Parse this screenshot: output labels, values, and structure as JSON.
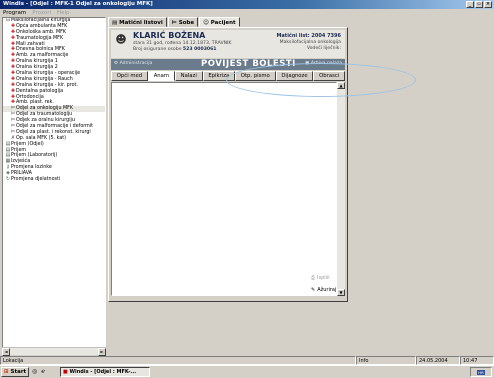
{
  "window": {
    "title": "Windis - [Odjel : MFK-1 Odjel za onkologiju MFK]"
  },
  "menu": [
    "Program",
    "Prozori",
    "Help"
  ],
  "tree": [
    {
      "label": "Maksilofacijalna kirurgija",
      "icon": "folder-icon",
      "indent": 0
    },
    {
      "label": "Opća ambulanta MFK",
      "icon": "plus-red-icon",
      "indent": 1
    },
    {
      "label": "Onkološka amb. MFK",
      "icon": "plus-red-icon",
      "indent": 1
    },
    {
      "label": "Traumatologija MFK",
      "icon": "plus-red-icon",
      "indent": 1
    },
    {
      "label": "Mali zahvati",
      "icon": "plus-red-icon",
      "indent": 1
    },
    {
      "label": "Dnevna bolnica MFK",
      "icon": "plus-red-icon",
      "indent": 1
    },
    {
      "label": "Amb. za malformacije",
      "icon": "plus-red-icon",
      "indent": 1
    },
    {
      "label": "Oralna kirurgija 1",
      "icon": "plus-red-icon",
      "indent": 1
    },
    {
      "label": "Oralna kirurgija 2",
      "icon": "plus-red-icon",
      "indent": 1
    },
    {
      "label": "Oralna kirurgija - operacije",
      "icon": "plus-red-icon",
      "indent": 1
    },
    {
      "label": "Oralna kirurgija - Rauch",
      "icon": "plus-red-icon",
      "indent": 1
    },
    {
      "label": "Oralna kirurgija - kir. prot.",
      "icon": "plus-red-icon",
      "indent": 1
    },
    {
      "label": "Dentalna patologija",
      "icon": "plus-red-icon",
      "indent": 1
    },
    {
      "label": "Ortodoncija",
      "icon": "plus-red-icon",
      "indent": 1
    },
    {
      "label": "Amb. plast. rek.",
      "icon": "plus-red-icon",
      "indent": 1
    },
    {
      "label": "Odjel za onkologiju MFK",
      "icon": "bed-icon",
      "indent": 1,
      "selected": true
    },
    {
      "label": "Odjel za traumatologiju",
      "icon": "bed-icon",
      "indent": 1
    },
    {
      "label": "Odjek za oralnu kirurgiju",
      "icon": "bed-icon",
      "indent": 1
    },
    {
      "label": "Odjel za malformacije i deformit",
      "icon": "bed-icon",
      "indent": 1
    },
    {
      "label": "Odjel za plast. i rekonst. kirurgi",
      "icon": "bed-icon",
      "indent": 1
    },
    {
      "label": "Op. sala MFK (5. kat)",
      "icon": "operating-icon",
      "indent": 1
    },
    {
      "label": "Prijem (Odjel)",
      "icon": "book-icon",
      "indent": 0
    },
    {
      "label": "Prijem",
      "icon": "book-icon",
      "indent": 0
    },
    {
      "label": "Prijem (Laboratorij)",
      "icon": "book-icon",
      "indent": 0
    },
    {
      "label": "Izvješća",
      "icon": "report-icon",
      "indent": 0
    },
    {
      "label": "Promjena lozinke",
      "icon": "key-icon",
      "indent": 0
    },
    {
      "label": "PRILIAVA",
      "icon": "login-icon",
      "indent": 0
    },
    {
      "label": "Promjena djelatnosti",
      "icon": "change-icon",
      "indent": 0
    }
  ],
  "top_tabs": [
    "Matični listovi",
    "Sobe",
    "Pacijent"
  ],
  "patient": {
    "name": "KLARIĆ BOŽENA",
    "info": "stara 31 god,  rođena 14.12.1873, TRAVNIK",
    "insurance_label": "Broj osigurane osobe",
    "insurance_number": "523 0003061",
    "master_list": "Matični list:  2004  7396",
    "department": "Maksilofacijalna onkologija",
    "doctor": "Vodeći liječnik:"
  },
  "strip": {
    "admin": "Administracija",
    "title": "POVIJEST BOLESTI",
    "archive": "Arhiva nalaza"
  },
  "sub_tabs": [
    "Opći med",
    "Anam",
    "Nalazi",
    "Epikriza",
    "Otp. pismo",
    "Dijagnoze",
    "Obrasci"
  ],
  "buttons": {
    "print": "Ispiši",
    "update": "Ažuriraj"
  },
  "status": {
    "left": "Lokacija",
    "info": "Info",
    "date": "24.05.2004",
    "time": "10:47"
  },
  "taskbar": {
    "start": "Start",
    "task": "Windis - [Odjel : MFK-...",
    "lang": "HR"
  },
  "colors": {
    "title_bar": "#0a246a",
    "strip": "#6a7c8c",
    "red_icon": "#d00000"
  }
}
